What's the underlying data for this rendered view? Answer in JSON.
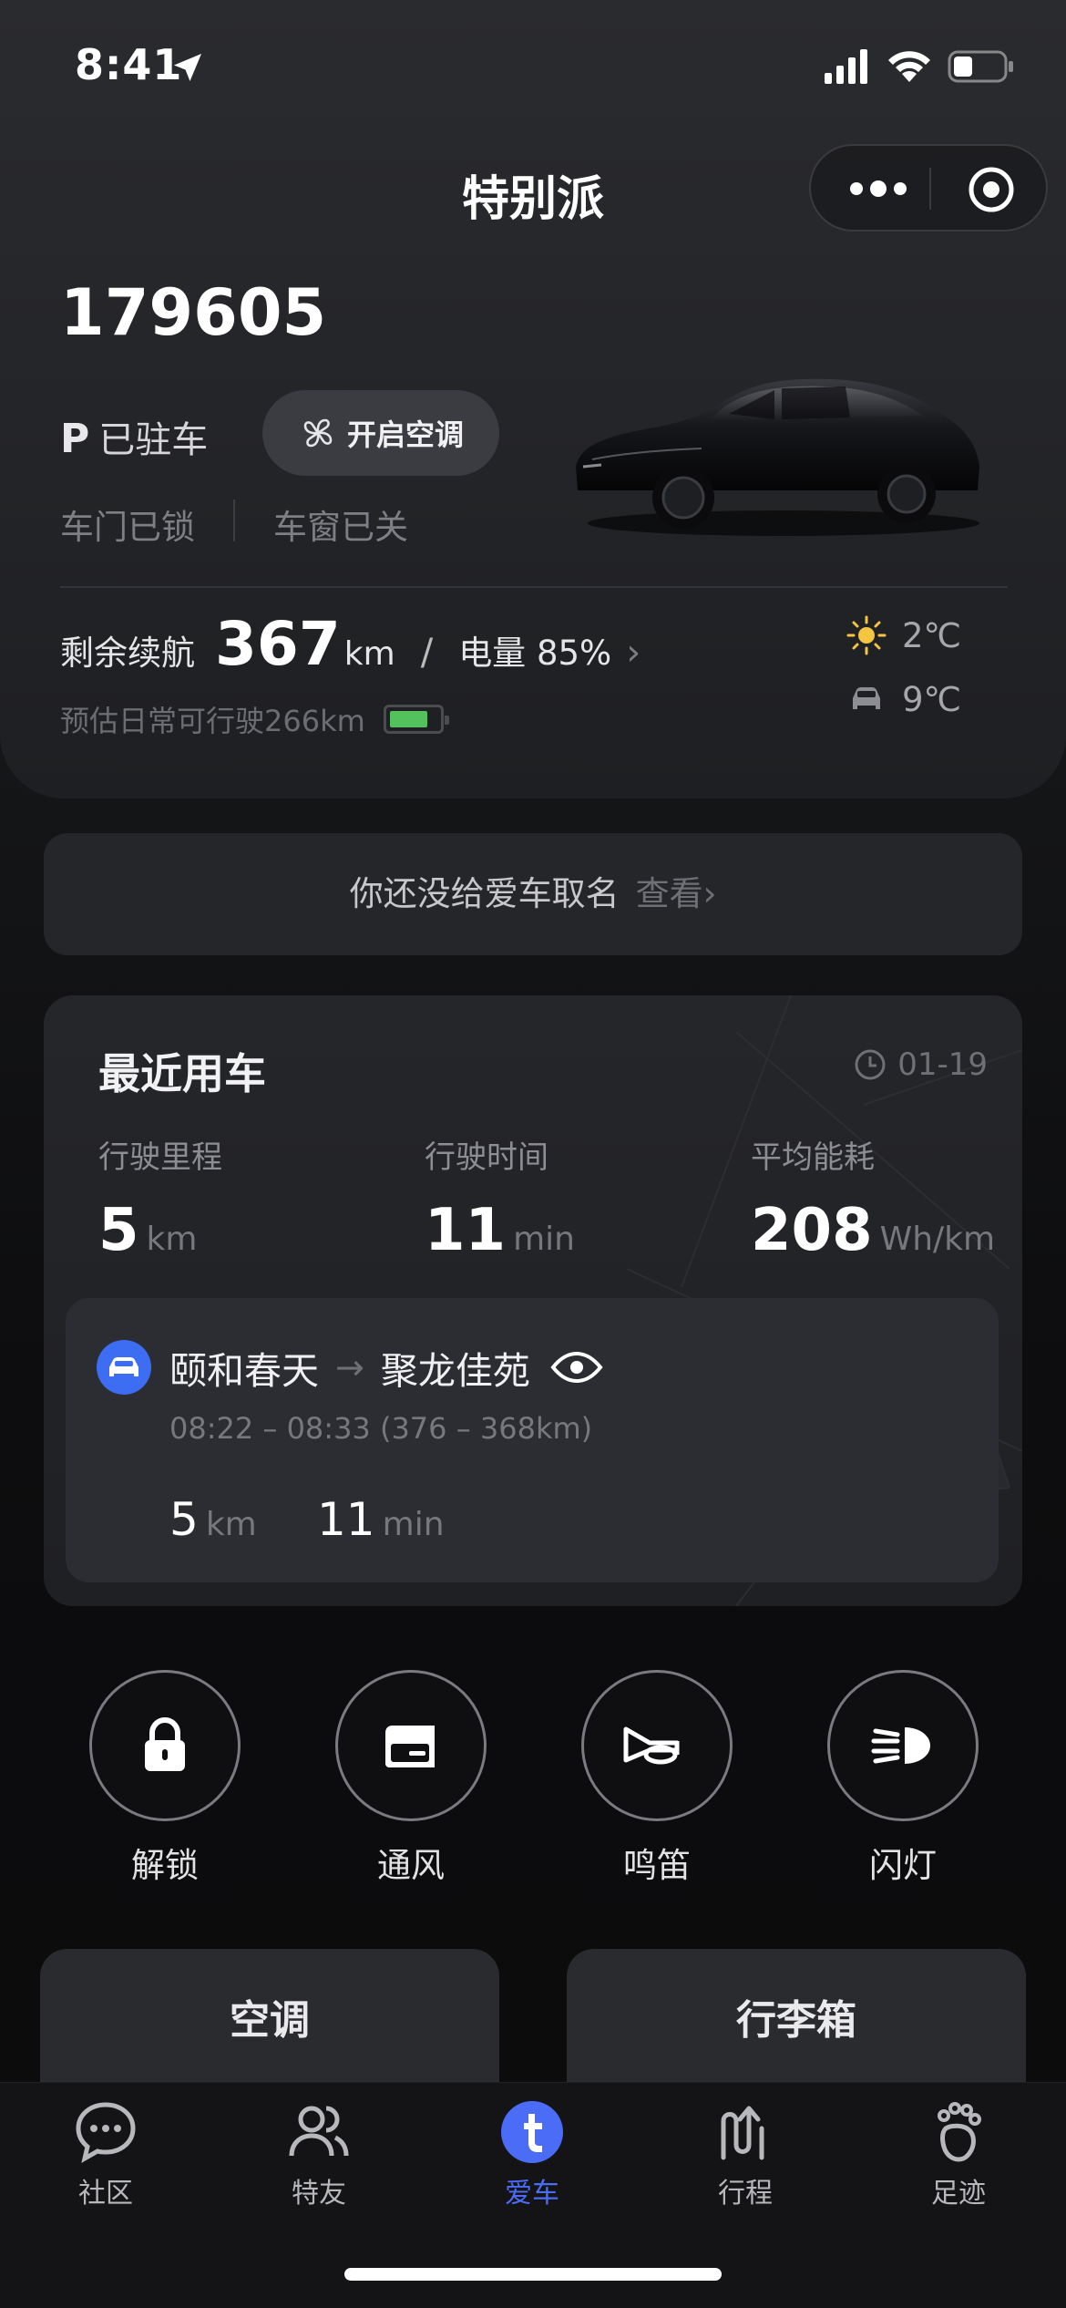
{
  "status_bar": {
    "time": "8:41",
    "icons": [
      "location-arrow-icon",
      "cellular-signal-icon",
      "wifi-icon",
      "battery-icon"
    ]
  },
  "nav": {
    "title": "特别派",
    "capsule_icons": [
      "more-dots-icon",
      "close-target-icon"
    ]
  },
  "vehicle": {
    "plate": "179605",
    "gear": "P",
    "state": "已驻车",
    "ac_button_label": "开启空调",
    "door_status": "车门已锁",
    "window_status": "车窗已关",
    "range_label": "剩余续航",
    "range_value": "367",
    "range_unit": "km",
    "slash": "/",
    "battery_label": "电量",
    "battery_percent": "85%",
    "battery_fill_fraction": 0.85,
    "estimate_text": "预估日常可行驶266km",
    "outside_temp": "2℃",
    "cabin_temp": "9℃"
  },
  "name_prompt": {
    "text": "你还没给爱车取名",
    "link": "查看"
  },
  "recent": {
    "title": "最近用车",
    "date": "01-19",
    "stats": [
      {
        "label": "行驶里程",
        "value": "5",
        "unit": "km"
      },
      {
        "label": "行驶时间",
        "value": "11",
        "unit": "min"
      },
      {
        "label": "平均能耗",
        "value": "208",
        "unit": "Wh/km"
      }
    ],
    "trip": {
      "from": "颐和春天",
      "arrow": "→",
      "to": "聚龙佳苑",
      "time_range": "08:22 – 08:33 (376 – 368km)",
      "distance_value": "5",
      "distance_unit": "km",
      "duration_value": "11",
      "duration_unit": "min"
    }
  },
  "quick_actions": [
    {
      "label": "解锁",
      "icon": "lock-icon"
    },
    {
      "label": "通风",
      "icon": "window-vent-icon"
    },
    {
      "label": "鸣笛",
      "icon": "horn-icon"
    },
    {
      "label": "闪灯",
      "icon": "headlight-icon"
    }
  ],
  "bottom_cards": [
    "空调",
    "行李箱"
  ],
  "tabs": [
    {
      "label": "社区",
      "icon": "chat-bubble-icon"
    },
    {
      "label": "特友",
      "icon": "friends-icon"
    },
    {
      "label": "爱车",
      "icon": "tesla-car-icon",
      "active": true
    },
    {
      "label": "行程",
      "icon": "route-icon"
    },
    {
      "label": "足迹",
      "icon": "footprint-icon"
    }
  ],
  "colors": {
    "accent": "#4a6cf7",
    "battery_green": "#53c15c",
    "background": "#0e0e10"
  }
}
